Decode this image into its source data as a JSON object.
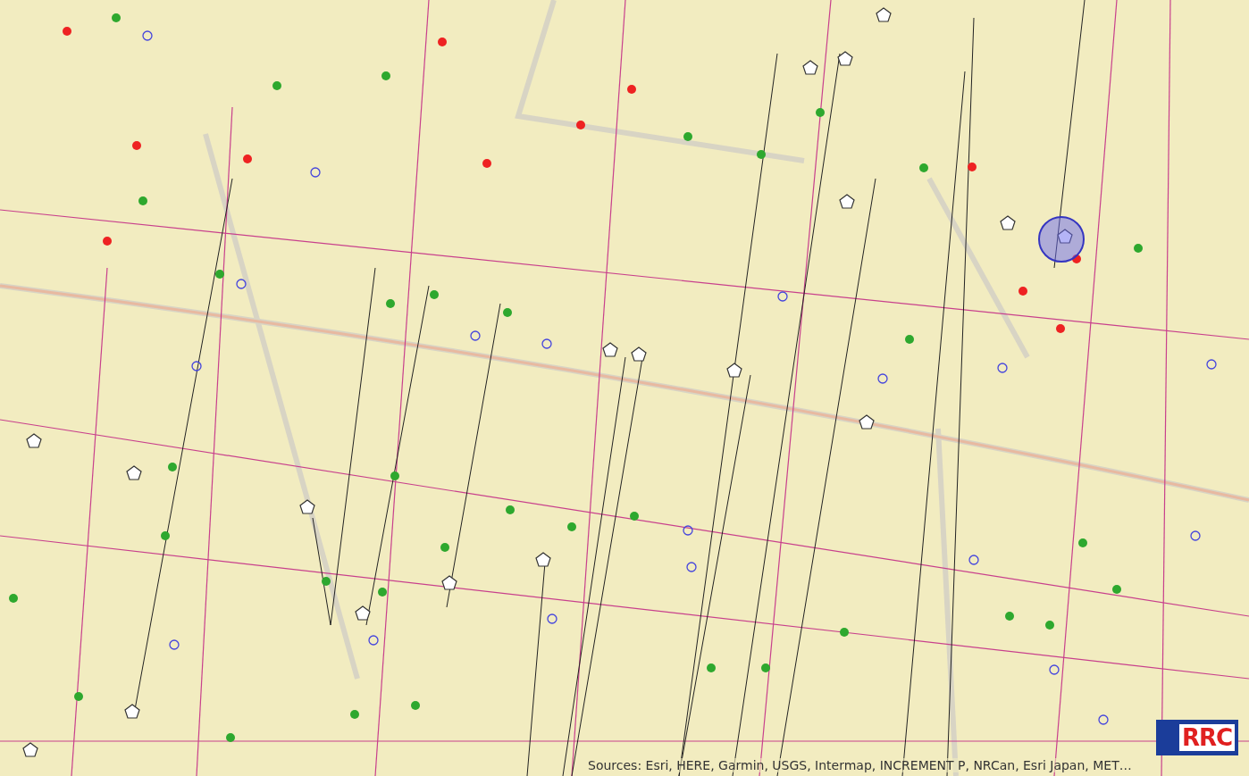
{
  "map": {
    "attribution": "Sources: Esri, HERE, Garmin, USGS, Intermap, INCREMENT P, NRCan, Esri Japan, MET…",
    "logo_text": "RRC"
  }
}
